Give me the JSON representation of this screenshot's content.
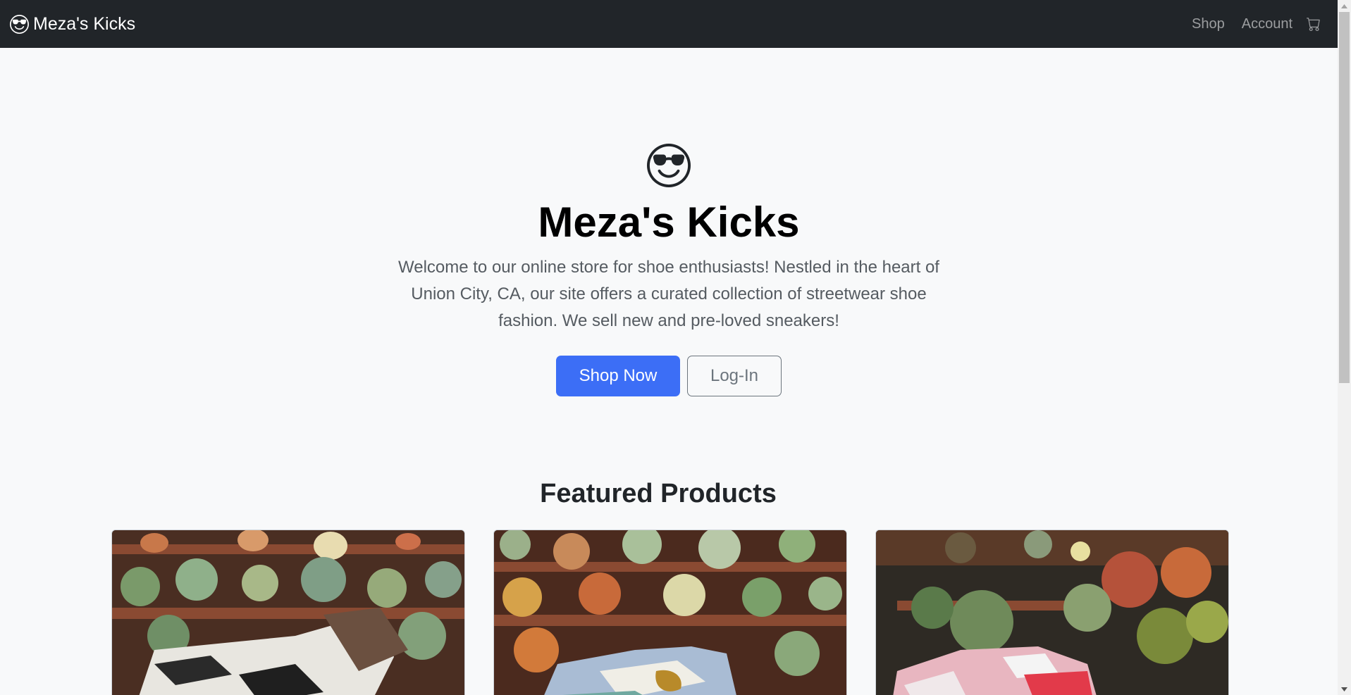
{
  "navbar": {
    "brand_icon": "sunglasses-smiley-icon",
    "brand_label": "Meza's Kicks",
    "links": [
      {
        "label": "Shop"
      },
      {
        "label": "Account"
      }
    ],
    "cart_icon": "cart-icon",
    "background_color": "#212529"
  },
  "hero": {
    "icon": "sunglasses-smiley-icon",
    "title": "Meza's Kicks",
    "lead": "Welcome to our online store for shoe enthusiasts! Nestled in the heart of Union City, CA, our site offers a curated collection of streetwear shoe fashion. We sell new and pre-loved sneakers!",
    "primary_button": "Shop Now",
    "secondary_button": "Log-In",
    "accent_color": "#3c6ef6"
  },
  "featured": {
    "title": "Featured Products",
    "products": [
      {
        "image": "sneaker-photo-1"
      },
      {
        "image": "sneaker-photo-2"
      },
      {
        "image": "sneaker-photo-3"
      }
    ]
  }
}
